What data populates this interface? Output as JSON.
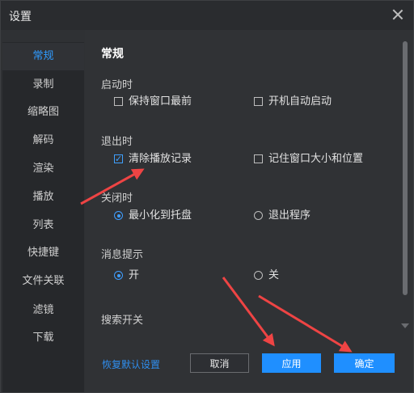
{
  "window": {
    "title": "设置"
  },
  "sidebar": {
    "items": [
      {
        "label": "常规",
        "active": true
      },
      {
        "label": "录制"
      },
      {
        "label": "缩略图"
      },
      {
        "label": "解码"
      },
      {
        "label": "渲染"
      },
      {
        "label": "播放"
      },
      {
        "label": "列表"
      },
      {
        "label": "快捷键"
      },
      {
        "label": "文件关联"
      },
      {
        "label": "滤镜"
      },
      {
        "label": "下载"
      }
    ]
  },
  "content": {
    "heading": "常规",
    "startup": {
      "title": "启动时",
      "options": [
        {
          "label": "保持窗口最前",
          "checked": false
        },
        {
          "label": "开机自动启动",
          "checked": false
        }
      ]
    },
    "exit": {
      "title": "退出时",
      "options": [
        {
          "label": "清除播放记录",
          "checked": true
        },
        {
          "label": "记住窗口大小和位置",
          "checked": false
        }
      ]
    },
    "close": {
      "title": "关闭时",
      "options": [
        {
          "label": "最小化到托盘",
          "selected": true
        },
        {
          "label": "退出程序",
          "selected": false
        }
      ]
    },
    "notify": {
      "title": "消息提示",
      "options": [
        {
          "label": "开",
          "selected": true
        },
        {
          "label": "关",
          "selected": false
        }
      ]
    },
    "search": {
      "title": "搜索开关"
    }
  },
  "footer": {
    "restore_label": "恢复默认设置",
    "cancel_label": "取消",
    "apply_label": "应用",
    "ok_label": "确定"
  },
  "colors": {
    "accent": "#1f8fff",
    "annotation": "#ee4444"
  }
}
